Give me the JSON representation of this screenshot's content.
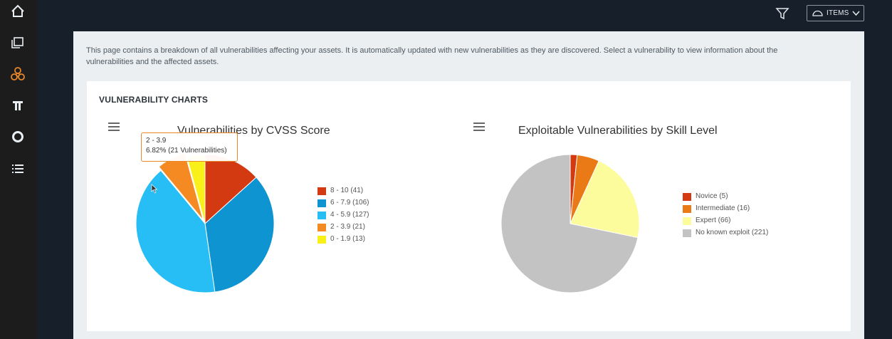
{
  "nav": {
    "items": [
      {
        "name": "home-icon",
        "active": false
      },
      {
        "name": "assets-icon",
        "active": false
      },
      {
        "name": "biohazard-icon",
        "active": true
      },
      {
        "name": "column-icon",
        "active": false
      },
      {
        "name": "ring-icon",
        "active": false
      },
      {
        "name": "list-icon",
        "active": false
      }
    ],
    "active_color": "#e8862a"
  },
  "topbar": {
    "items_label": "ITEMS"
  },
  "page": {
    "intro": "This page contains a breakdown of all vulnerabilities affecting your assets. It is automatically updated with new vulnerabilities as they are discovered. Select a vulnerability to view information about the vulnerabilities and the affected assets."
  },
  "card": {
    "title": "VULNERABILITY CHARTS"
  },
  "tooltip": {
    "line1": "2 - 3.9",
    "line2": "6.82% (21 Vulnerabilities)"
  },
  "chart_data": [
    {
      "type": "pie",
      "title": "Vulnerabilities by CVSS Score",
      "legend_position": "right",
      "slices": [
        {
          "label": "8 - 10",
          "value": 41,
          "legend": "8 - 10 (41)",
          "color": "#d33a12"
        },
        {
          "label": "6 - 7.9",
          "value": 106,
          "legend": "6 - 7.9 (106)",
          "color": "#0f94d2"
        },
        {
          "label": "4 - 5.9",
          "value": 127,
          "legend": "4 - 5.9 (127)",
          "color": "#27bdf5"
        },
        {
          "label": "2 - 3.9",
          "value": 21,
          "legend": "2 - 3.9 (21)",
          "color": "#f58a22"
        },
        {
          "label": "0 - 1.9",
          "value": 13,
          "legend": "0 - 1.9 (13)",
          "color": "#f8f018"
        }
      ],
      "hovered": "2 - 3.9"
    },
    {
      "type": "pie",
      "title": "Exploitable Vulnerabilities by Skill Level",
      "legend_position": "right",
      "slices": [
        {
          "label": "Novice",
          "value": 5,
          "legend": "Novice (5)",
          "color": "#d33a12"
        },
        {
          "label": "Intermediate",
          "value": 16,
          "legend": "Intermediate (16)",
          "color": "#ea7a15"
        },
        {
          "label": "Expert",
          "value": 66,
          "legend": "Expert (66)",
          "color": "#fdfc9c"
        },
        {
          "label": "No known exploit",
          "value": 221,
          "legend": "No known exploit (221)",
          "color": "#c3c3c3"
        }
      ]
    }
  ]
}
